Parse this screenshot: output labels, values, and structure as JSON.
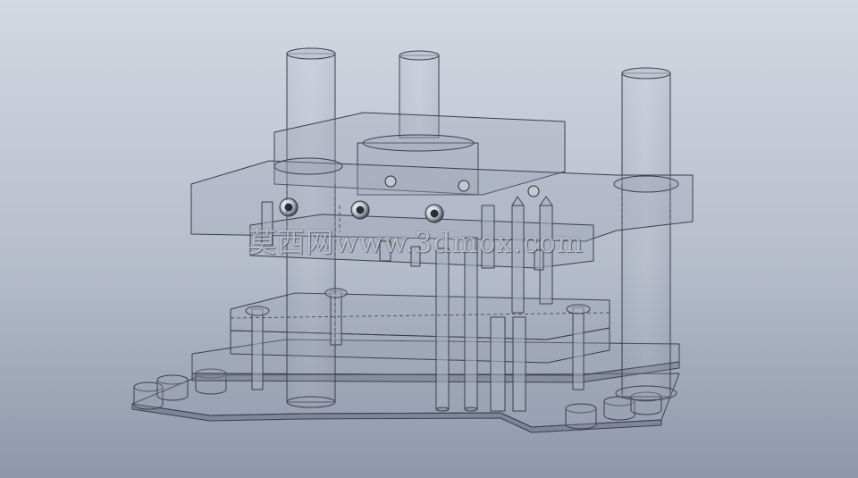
{
  "scene": {
    "subject": "transparent press die assembly with guide pillars",
    "background_top": "#cdd3de",
    "background_bottom": "#8f98aa",
    "part_fill": "#9aa2b4",
    "edge_color": "#3a3f4c"
  },
  "watermark": {
    "text": "莫西网www.3dmox.com"
  }
}
